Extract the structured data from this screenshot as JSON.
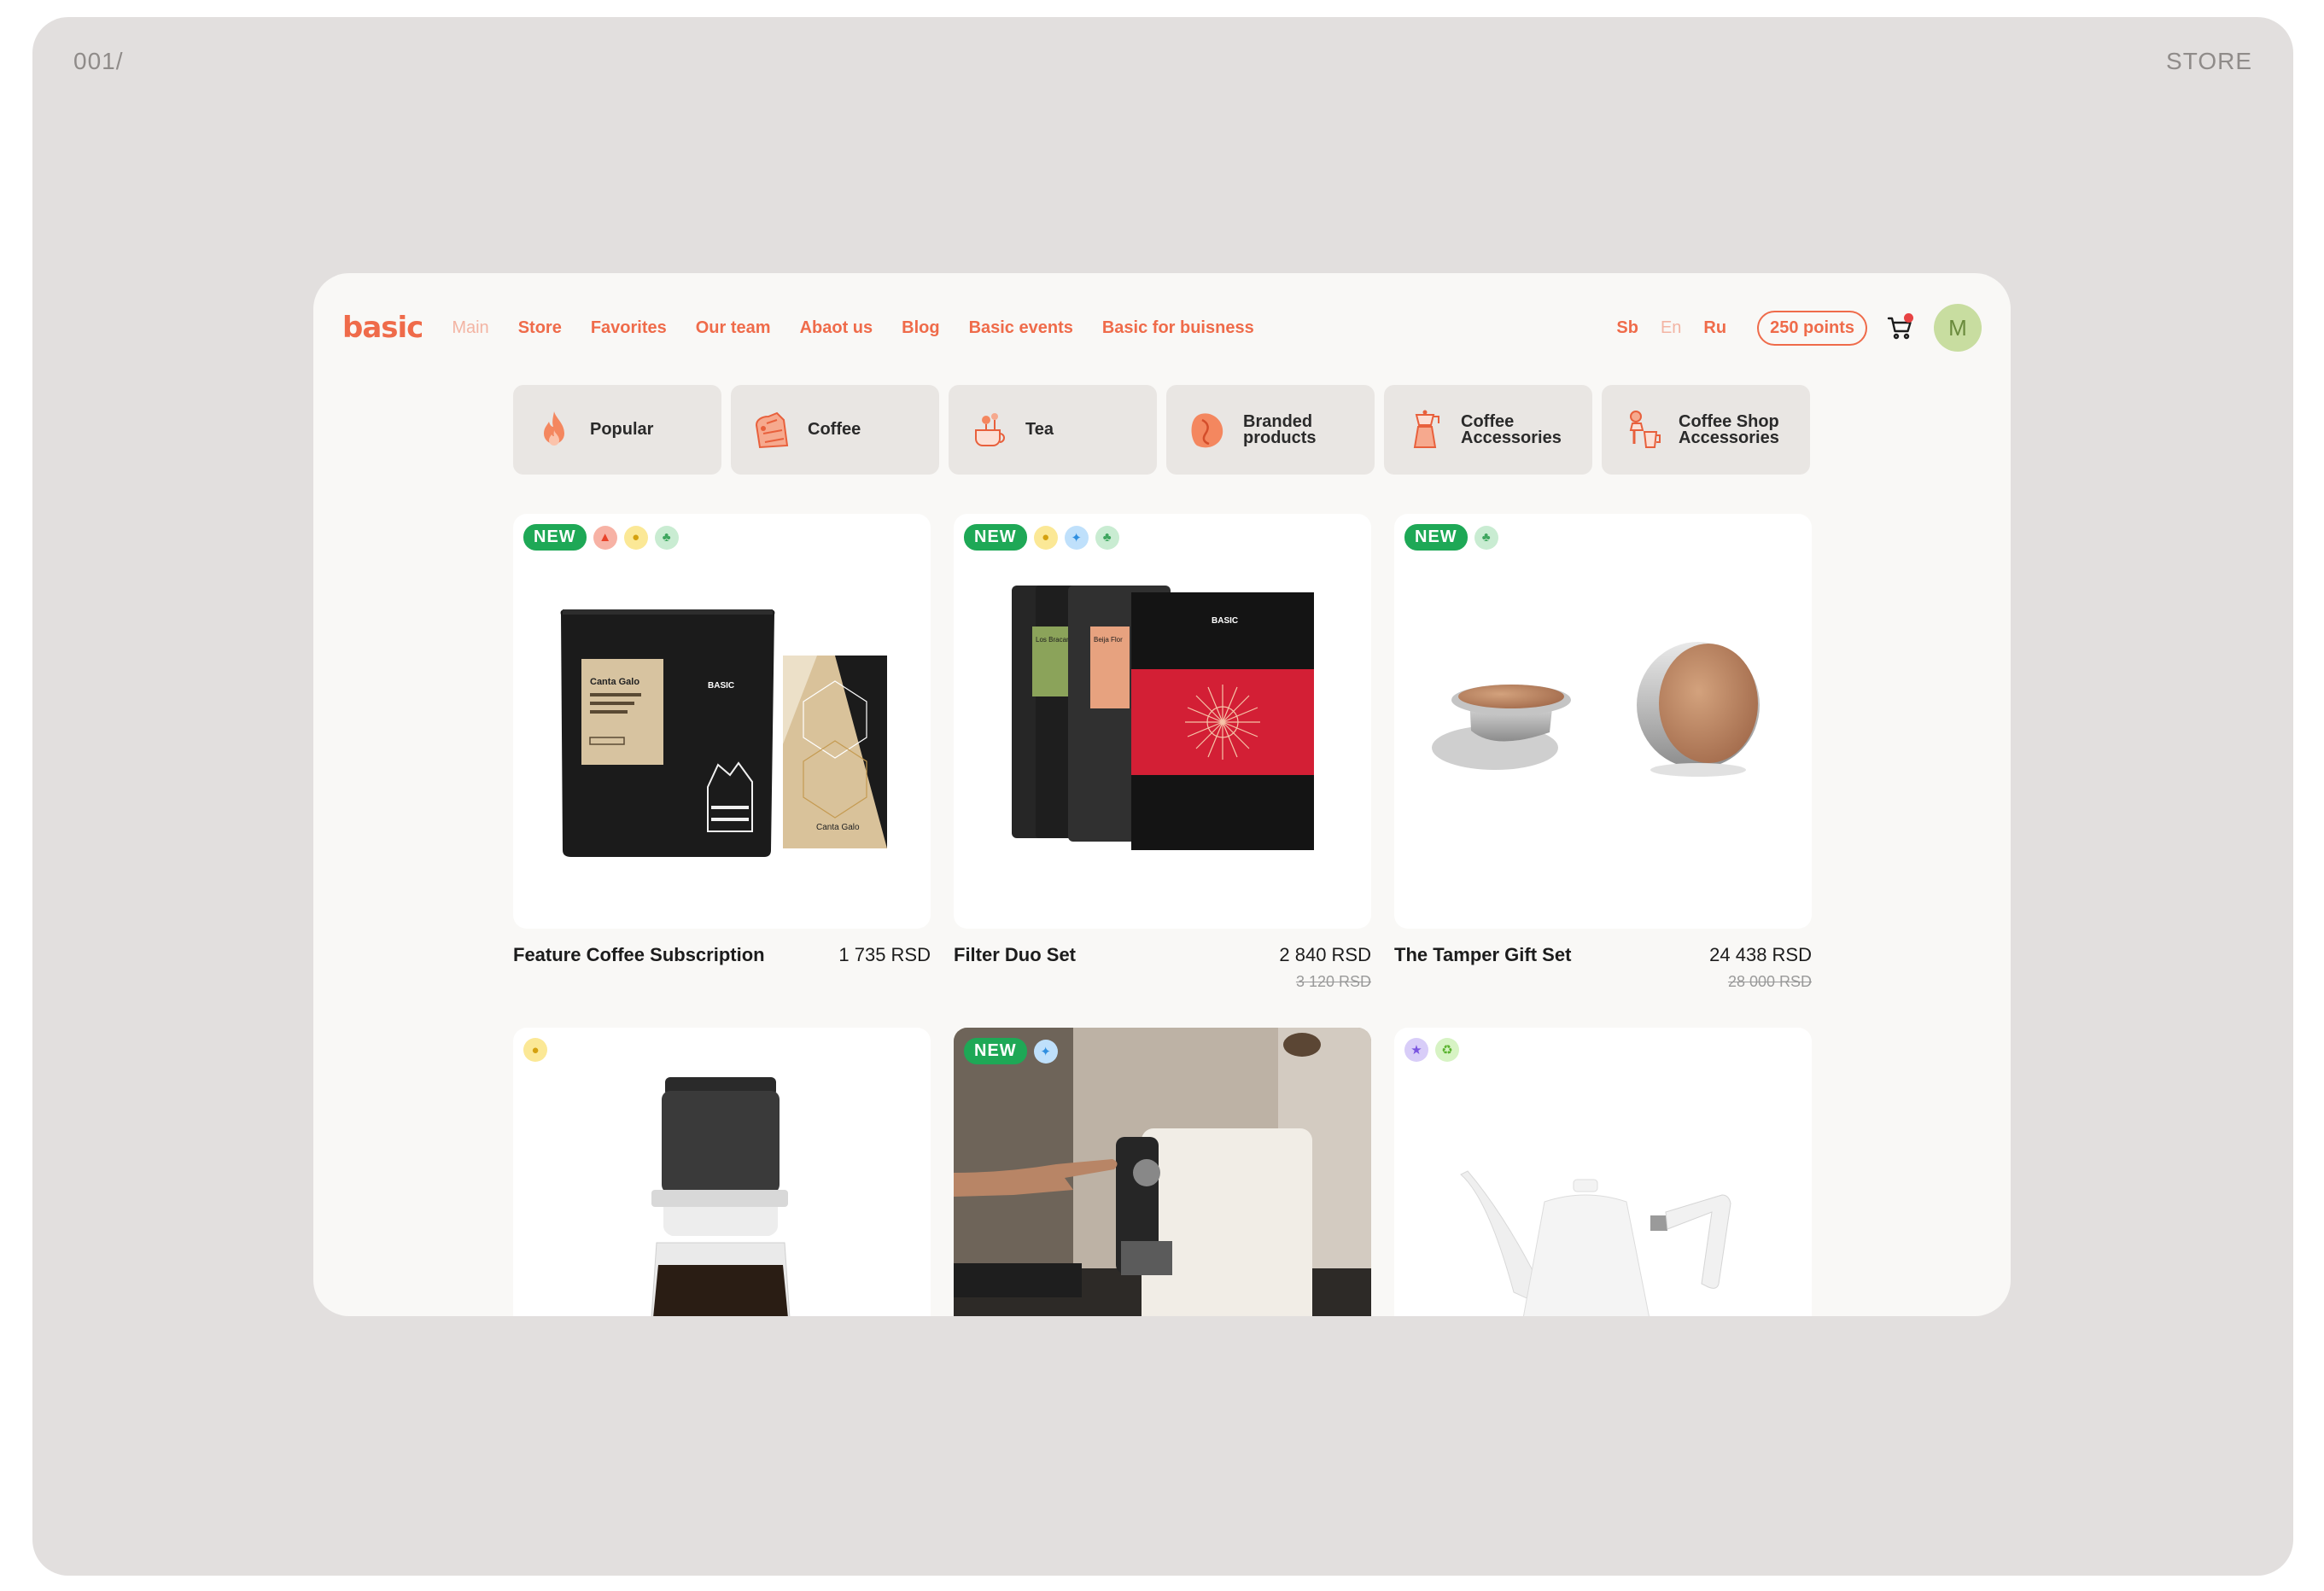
{
  "board": {
    "number": "001/",
    "title": "STORE"
  },
  "nav": {
    "logo": "basic",
    "links": [
      "Main",
      "Store",
      "Favorites",
      "Our team",
      "Abaot us",
      "Blog",
      "Basic events",
      "Basic for buisness"
    ],
    "languages": [
      "Sb",
      "En",
      "Ru"
    ],
    "points": "250 points",
    "avatar_letter": "M"
  },
  "categories": [
    {
      "label": "Popular",
      "icon": "flame-icon"
    },
    {
      "label": "Coffee",
      "icon": "coffee-bag-icon"
    },
    {
      "label": "Tea",
      "icon": "teapot-icon"
    },
    {
      "label": "Branded\nproducts",
      "icon": "branded-bean-icon"
    },
    {
      "label": "Coffee\nAccessories",
      "icon": "moka-pot-icon"
    },
    {
      "label": "Coffee Shop\nAccessories",
      "icon": "grinder-icon"
    }
  ],
  "products": [
    {
      "name": "Feature Coffee Subscription",
      "price": "1 735 RSD",
      "old_price": "",
      "new_label": "NEW",
      "badges": [
        "fire",
        "like",
        "leaf"
      ]
    },
    {
      "name": "Filter Duo Set",
      "price": "2 840 RSD",
      "old_price": "3 120 RSD",
      "new_label": "NEW",
      "badges": [
        "like",
        "bolt",
        "leaf"
      ]
    },
    {
      "name": "The Tamper Gift Set",
      "price": "24 438 RSD",
      "old_price": "28 000 RSD",
      "new_label": "NEW",
      "badges": [
        "leaf"
      ]
    },
    {
      "name": "",
      "price": "",
      "old_price": "",
      "new_label": "",
      "badges": [
        "like"
      ]
    },
    {
      "name": "",
      "price": "",
      "old_price": "",
      "new_label": "NEW",
      "badges": [
        "bolt"
      ]
    },
    {
      "name": "",
      "price": "",
      "old_price": "",
      "new_label": "",
      "badges": [
        "crown",
        "recycle"
      ]
    }
  ],
  "packaging": {
    "bag_label": "Canta Galo",
    "brand": "BASIC",
    "duo_left": "Los Bracamoros",
    "duo_right": "Beija Flor"
  },
  "colors": {
    "accent": "#ef6b4a",
    "new_badge": "#1ea856",
    "board": "#e2dfde",
    "window": "#f9f8f6"
  }
}
